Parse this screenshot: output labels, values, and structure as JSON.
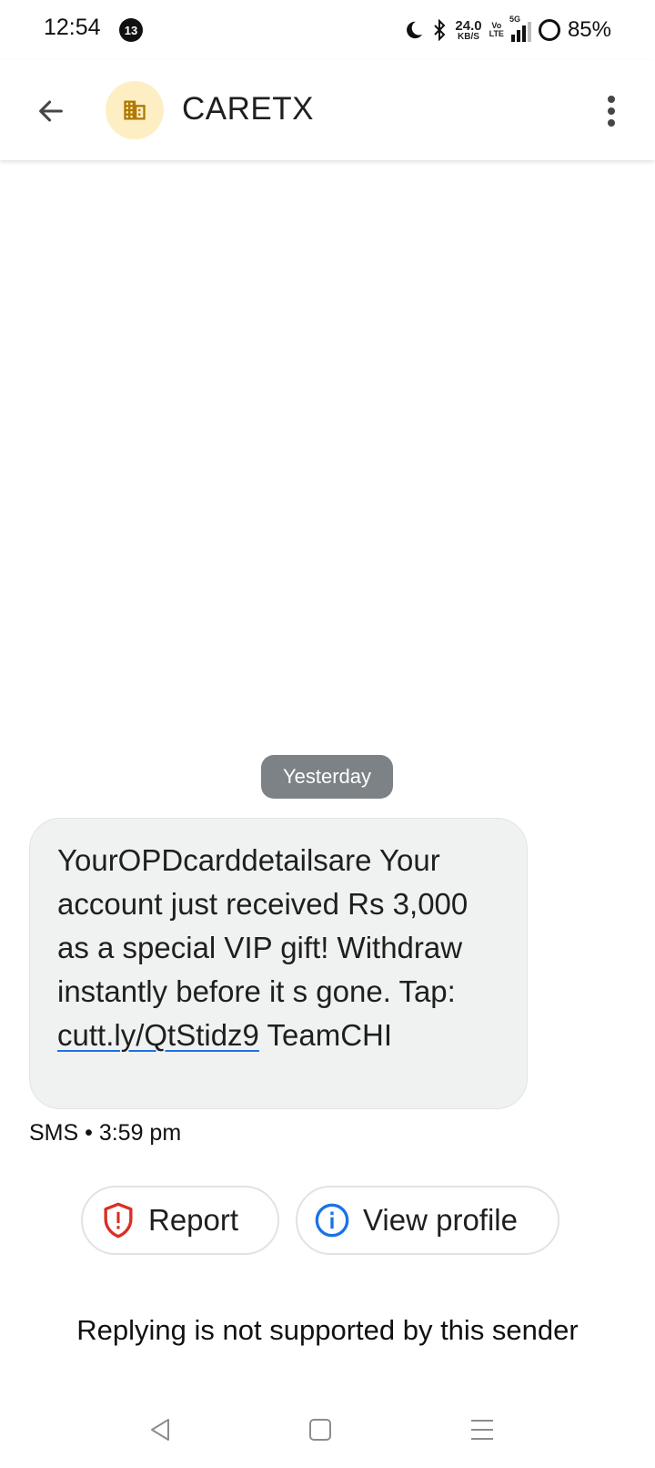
{
  "status_bar": {
    "time": "12:54",
    "notification_count": "13",
    "net_speed_value": "24.0",
    "net_speed_unit": "KB/S",
    "volte_top": "Vo",
    "volte_bottom": "LTE",
    "network_type": "5G",
    "battery": "85%"
  },
  "header": {
    "sender": "CARETX",
    "avatar_icon": "building-icon",
    "avatar_bg": "#fdefc3"
  },
  "conversation": {
    "date_chip": "Yesterday",
    "message": {
      "text_before_link": "YourOPDcarddetailsare Your account just received Rs 3,000 as a special VIP gift! Withdraw instantly before it s gone. Tap: ",
      "link": "cutt.ly/QtStidz9",
      "text_after_link": " TeamCHI"
    },
    "meta": "SMS • 3:59 pm"
  },
  "actions": {
    "report_label": "Report",
    "view_profile_label": "View profile"
  },
  "footer_note": "Replying is not supported by this sender",
  "colors": {
    "accent_blue": "#1a73e8",
    "report_red": "#d93025",
    "avatar_icon": "#b07a00"
  }
}
